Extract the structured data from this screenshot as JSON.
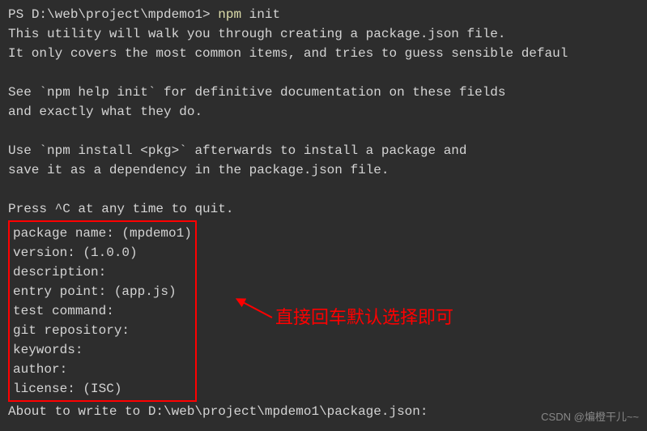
{
  "terminal": {
    "prompt_prefix": "PS ",
    "prompt_path": "D:\\web\\project\\mpdemo1> ",
    "command_name": "npm",
    "command_arg": " init",
    "line2": "This utility will walk you through creating a package.json file.",
    "line3": "It only covers the most common items, and tries to guess sensible defaul",
    "line5": "See `npm help init` for definitive documentation on these fields",
    "line6": "and exactly what they do.",
    "line8": "Use `npm install <pkg>` afterwards to install a package and",
    "line9": "save it as a dependency in the package.json file.",
    "line11": "Press ^C at any time to quit.",
    "prompts": {
      "package_name": "package name: (mpdemo1)",
      "version": "version: (1.0.0)",
      "description": "description:",
      "entry_point": "entry point: (app.js)",
      "test_command": "test command:",
      "git_repository": "git repository:",
      "keywords": "keywords:",
      "author": "author:",
      "license": "license: (ISC)"
    },
    "line_about": "About to write to D:\\web\\project\\mpdemo1\\package.json:"
  },
  "annotation_text": "直接回车默认选择即可",
  "watermark": "CSDN @煸橙干儿~~"
}
